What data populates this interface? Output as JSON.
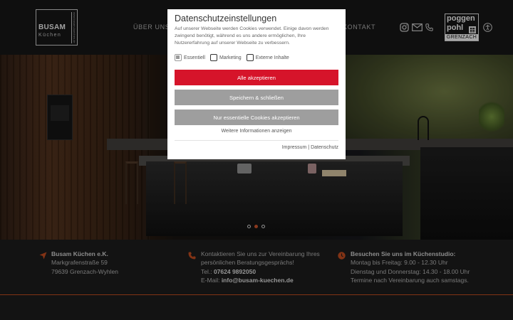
{
  "header": {
    "logo": {
      "main": "BUSAM",
      "sub": "Küchen",
      "side": "www.busam-kuechen.de"
    },
    "nav": [
      {
        "label": "ÜBER UNS"
      },
      {
        "label": "KONTAKT"
      }
    ],
    "icons": [
      "instagram-icon",
      "mail-icon",
      "phone-icon",
      "accessibility-icon"
    ],
    "partner": {
      "line1": "poggen",
      "line2": "pohl",
      "line3": "GRENZACH"
    }
  },
  "slider": {
    "count": 3,
    "active_index": 1
  },
  "info": {
    "address": {
      "title": "Busam Küchen e.K.",
      "street": "Markgrafenstraße 59",
      "city": "79639 Grenzach-Wyhlen"
    },
    "contact": {
      "text": "Kontaktieren Sie uns zur Vereinbarung Ihres persönlichen Beratungsgesprächs!",
      "tel_label": "Tel.: ",
      "tel": "07624 9892050",
      "email_label": "E-Mail: ",
      "email": "info@busam-kuechen.de"
    },
    "hours": {
      "title": "Besuchen Sie uns im Küchenstudio:",
      "line1": "Montag bis Freitag: 9.00 - 12.30 Uhr",
      "line2": "Dienstag und Donnerstag: 14.30 - 18.00 Uhr",
      "line3": "Termine nach Vereinbarung auch samstags."
    }
  },
  "cookie": {
    "title": "Datenschutzeinstellungen",
    "text": "Auf unserer Webseite werden Cookies verwendet. Einige davon werden zwingend benötigt, während es uns andere ermöglichen, Ihre Nutzererfahrung auf unserer Webseite zu verbessern.",
    "options": [
      {
        "label": "Essentiell",
        "checked": true
      },
      {
        "label": "Marketing",
        "checked": false
      },
      {
        "label": "Externe Inhalte",
        "checked": false
      }
    ],
    "accept_all": "Alle akzeptieren",
    "save_close": "Speichern & schließen",
    "essential_only": "Nur essentielle Cookies akzeptieren",
    "more_info": "Weitere Informationen anzeigen",
    "footer": {
      "impressum": "Impressum",
      "separator": "|",
      "datenschutz": "Datenschutz"
    }
  },
  "colors": {
    "accent": "#d6142a",
    "brand_orange": "#b5471e",
    "grey_button": "#9e9e9e"
  }
}
